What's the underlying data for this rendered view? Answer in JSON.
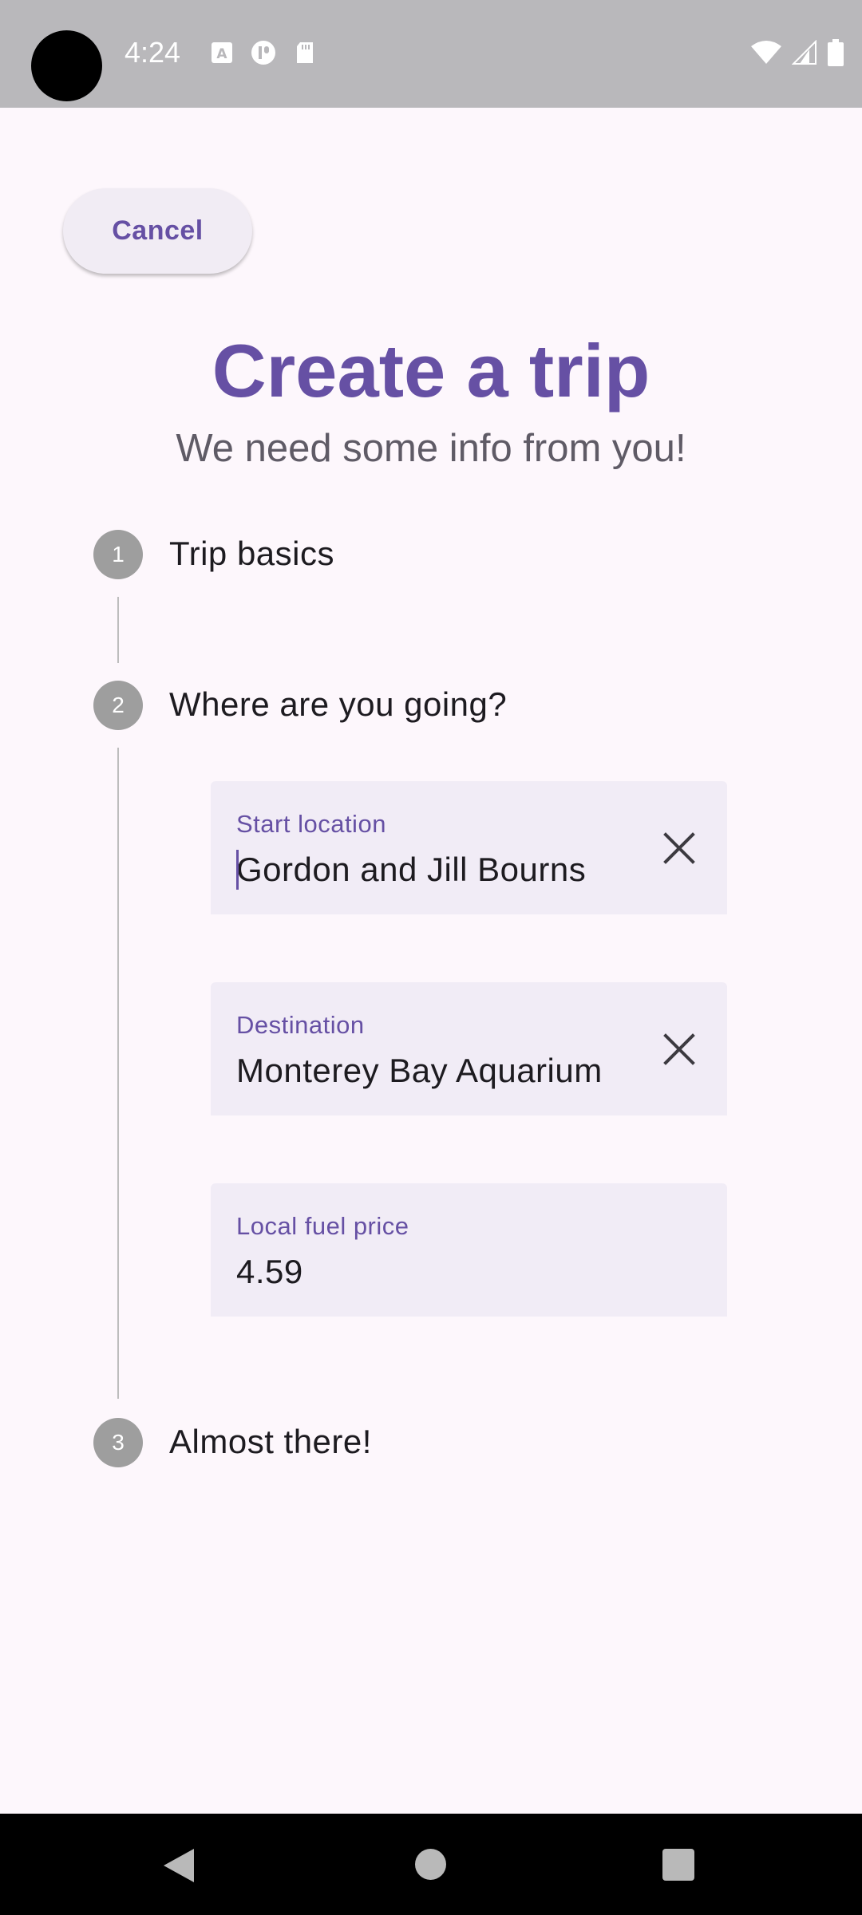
{
  "status_bar": {
    "time": "4:24",
    "left_icons": [
      "a-box-icon",
      "p-circle-icon",
      "sd-card-icon"
    ],
    "right_icons": [
      "wifi-icon",
      "cell-signal-icon",
      "battery-icon"
    ]
  },
  "header": {
    "cancel_label": "Cancel",
    "title": "Create a trip",
    "subtitle": "We need some info from you!"
  },
  "stepper": {
    "steps": [
      {
        "number": "1",
        "title": "Trip basics"
      },
      {
        "number": "2",
        "title": "Where are you going?"
      },
      {
        "number": "3",
        "title": "Almost there!"
      }
    ]
  },
  "form": {
    "start_location": {
      "label": "Start location",
      "value": "Gordon and Jill Bourns"
    },
    "destination": {
      "label": "Destination",
      "value": "Monterey Bay Aquarium"
    },
    "fuel_price": {
      "label": "Local fuel price",
      "value": "4.59"
    }
  },
  "colors": {
    "accent": "#6650a4",
    "background": "#fdf7fc",
    "field_bg": "#f1ecf6",
    "step_circle": "#9e9e9e"
  }
}
